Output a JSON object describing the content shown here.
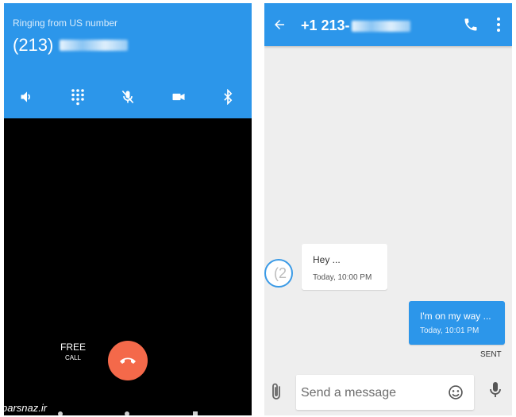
{
  "call": {
    "status": "Ringing from US number",
    "number_prefix": "(213)",
    "free_label": "FREE",
    "call_label": "CALL",
    "controls": [
      "speaker-icon",
      "dialpad-icon",
      "mute-mic-icon",
      "video-icon",
      "bluetooth-icon"
    ],
    "accent_color": "#2c96ea",
    "end_call_color": "#f4694a"
  },
  "watermark": "parsnaz.ir",
  "messaging": {
    "title_prefix": "+1 213-",
    "messages": [
      {
        "direction": "incoming",
        "avatar_text": "(2",
        "text": "Hey ...",
        "time": "Today, 10:00 PM"
      },
      {
        "direction": "outgoing",
        "text": "I'm on my way ...",
        "time": "Today, 10:01 PM",
        "status": "SENT"
      }
    ],
    "compose_placeholder": "Send a message",
    "accent_color": "#2c96ea"
  }
}
